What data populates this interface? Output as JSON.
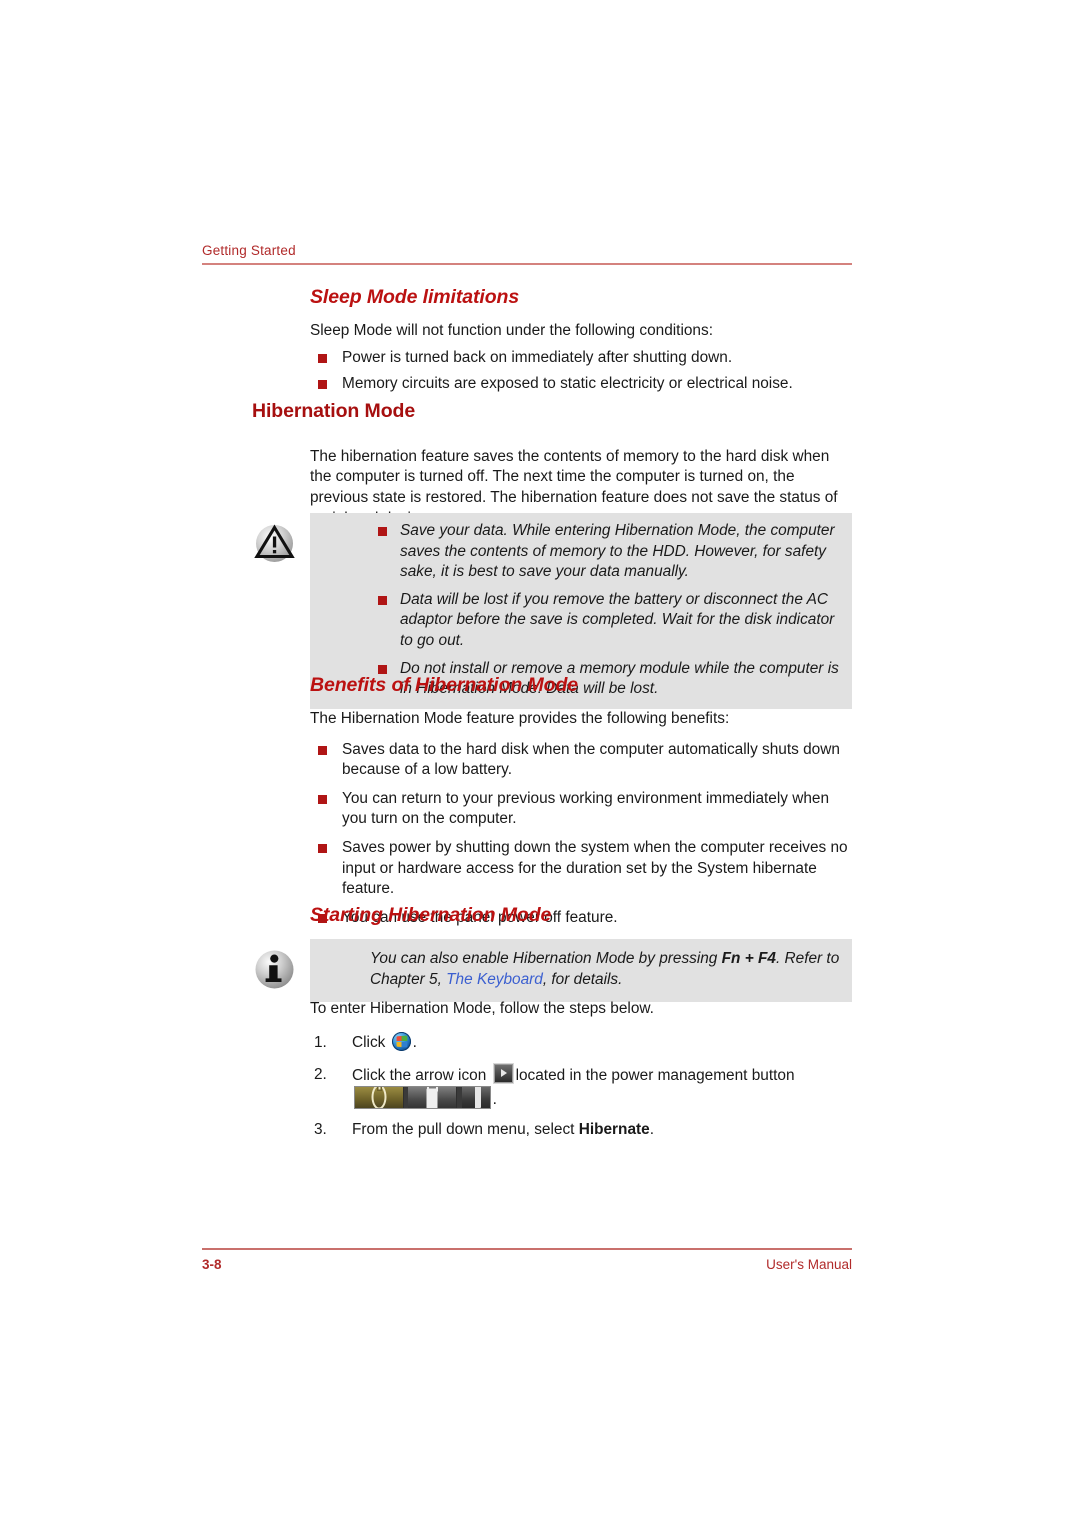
{
  "header": {
    "chapter_label": "Getting Started"
  },
  "footer": {
    "page_number": "3-8",
    "manual_label": "User's Manual"
  },
  "colors": {
    "heading_red": "#a60f0f",
    "subheading_red": "#bb1111",
    "header_rule": "#d4827e",
    "bullet_square": "#b01515",
    "callout_bg": "#e1e1e1",
    "link_blue": "#3b5fd0"
  },
  "sections": {
    "sleep_limitations": {
      "heading": "Sleep Mode limitations",
      "intro": "Sleep Mode will not function under the following conditions:",
      "bullets": [
        "Power is turned back on immediately after shutting down.",
        "Memory circuits are exposed to static electricity or electrical noise."
      ]
    },
    "hibernation_mode": {
      "heading": "Hibernation Mode",
      "paragraph": "The hibernation feature saves the contents of memory to the hard disk when the computer is turned off. The next time the computer is turned on, the previous state is restored. The hibernation feature does not save the status of peripheral devices."
    },
    "warning_callout": {
      "icon": "warning-triangle-icon",
      "bullets": [
        "Save your data. While entering Hibernation Mode, the computer saves the contents of memory to the HDD. However, for safety sake, it is best to save your data manually.",
        "Data will be lost if you remove the battery or disconnect the AC adaptor before the save is completed. Wait for the disk indicator to go out.",
        "Do not install or remove a memory module while the computer is in Hibernation Mode. Data will be lost."
      ]
    },
    "benefits": {
      "heading": "Benefits of Hibernation Mode",
      "intro": "The Hibernation Mode feature provides the following benefits:",
      "bullets": [
        "Saves data to the hard disk when the computer automatically shuts down because of a low battery.",
        "You can return to your previous working environment immediately when you turn on the computer.",
        "Saves power by shutting down the system when the computer receives no input or hardware access for the duration set by the System hibernate feature.",
        "You can use the panel power off feature."
      ]
    },
    "starting": {
      "heading": "Starting Hibernation Mode",
      "info_callout": {
        "icon": "info-circle-icon",
        "text_before_bold": "You can also enable Hibernation Mode by pressing ",
        "bold_keys": "Fn + F4",
        "text_after_bold": ". Refer to Chapter 5, ",
        "link_text": "The Keyboard",
        "text_end": ", for details."
      },
      "intro": "To enter Hibernation Mode, follow the steps below.",
      "steps": [
        {
          "number": "1.",
          "text_before": "Click",
          "icon": "windows-start-orb-icon",
          "text_after": "."
        },
        {
          "number": "2.",
          "text_before": "Click the arrow icon",
          "icon": "arrow-button-icon",
          "text_mid": "located in the power management button",
          "widget": "power-management-button",
          "text_after": "."
        },
        {
          "number": "3.",
          "text_before": "From the pull down menu, select ",
          "bold_word": "Hibernate",
          "text_after": "."
        }
      ]
    }
  }
}
